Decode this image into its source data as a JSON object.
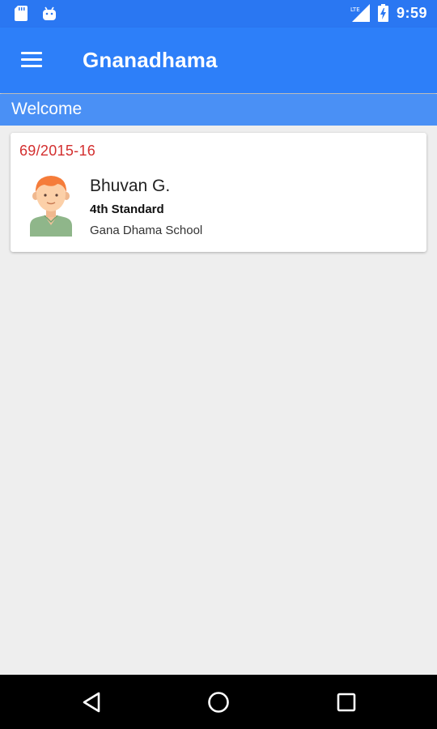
{
  "status_bar": {
    "time": "9:59",
    "icons": [
      "sd-card-icon",
      "android-icon",
      "lte-signal-icon",
      "battery-charging-icon"
    ]
  },
  "app_bar": {
    "title": "Gnanadhama",
    "menu_icon": "hamburger-menu-icon"
  },
  "welcome": {
    "text": "Welcome"
  },
  "student_card": {
    "id": "69/2015-16",
    "name": "Bhuvan G.",
    "class": "4th Standard",
    "school": "Gana Dhama School",
    "avatar_icon": "student-avatar-icon",
    "id_color": "#d32f2f"
  },
  "nav_bar": {
    "icons": [
      "back-icon",
      "home-icon",
      "recents-icon"
    ]
  },
  "colors": {
    "status_bar": "#2a77f2",
    "app_bar": "#2d7ff9",
    "welcome_bar": "#4a90f5",
    "background": "#eeeeee"
  }
}
